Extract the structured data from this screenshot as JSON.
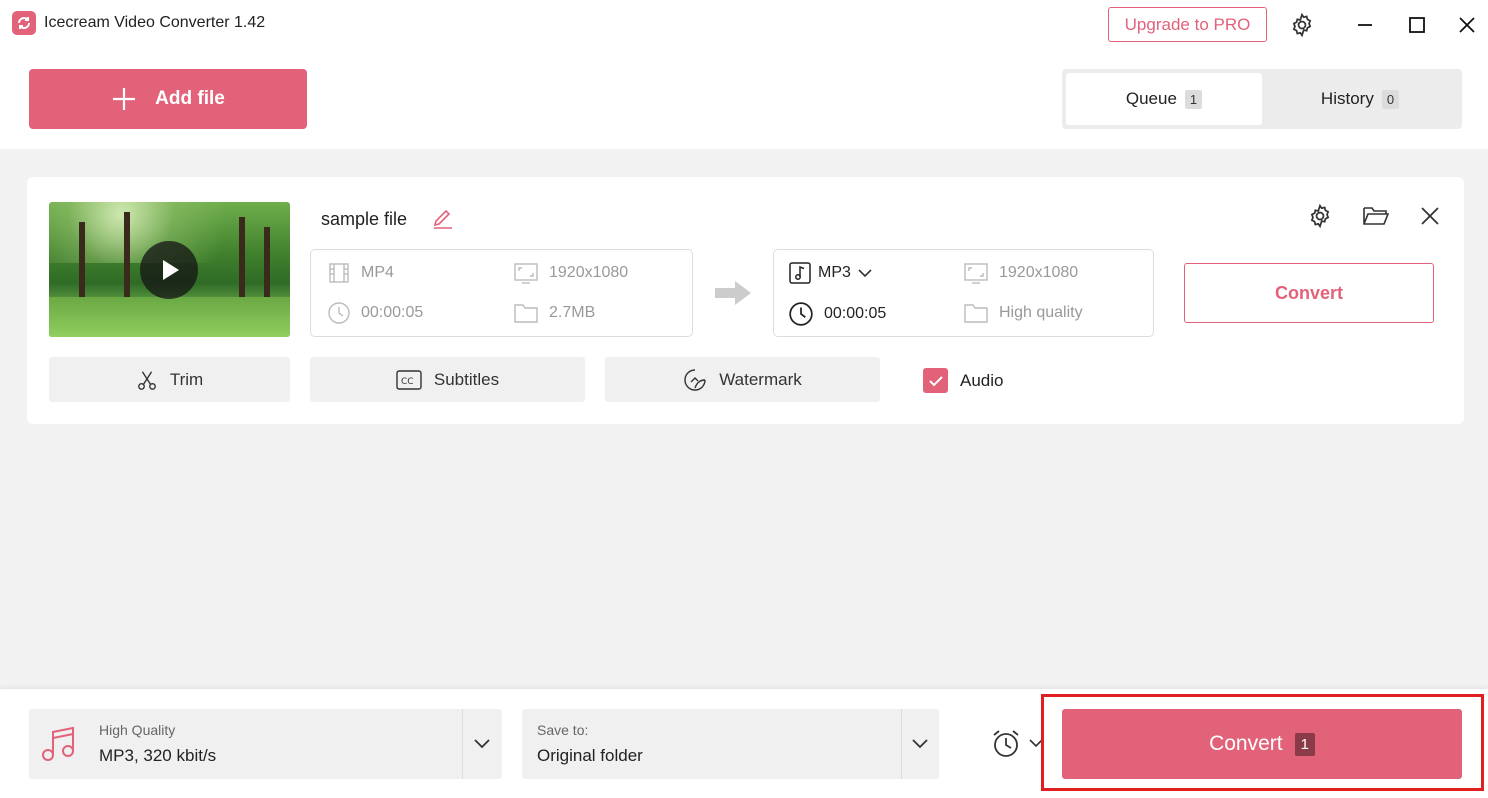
{
  "app": {
    "title": "Icecream Video Converter 1.42",
    "upgrade_label": "Upgrade to PRO"
  },
  "toolbar": {
    "add_file_label": "Add file"
  },
  "tabs": [
    {
      "label": "Queue",
      "count": "1",
      "active": true
    },
    {
      "label": "History",
      "count": "0",
      "active": false
    }
  ],
  "file": {
    "name": "sample file",
    "source": {
      "format": "MP4",
      "resolution": "1920x1080",
      "duration": "00:00:05",
      "size": "2.7MB"
    },
    "target": {
      "format": "MP3",
      "resolution": "1920x1080",
      "duration": "00:00:05",
      "quality": "High quality"
    },
    "convert_label": "Convert"
  },
  "tools": {
    "trim_label": "Trim",
    "subtitles_label": "Subtitles",
    "watermark_label": "Watermark",
    "audio_label": "Audio",
    "audio_checked": true
  },
  "bottom": {
    "preset_title": "High Quality",
    "preset_value": "MP3, 320 kbit/s",
    "save_to_label": "Save to:",
    "save_to_value": "Original folder",
    "convert_label": "Convert",
    "convert_count": "1"
  },
  "colors": {
    "accent": "#e2627a",
    "highlight": "#e02020"
  }
}
